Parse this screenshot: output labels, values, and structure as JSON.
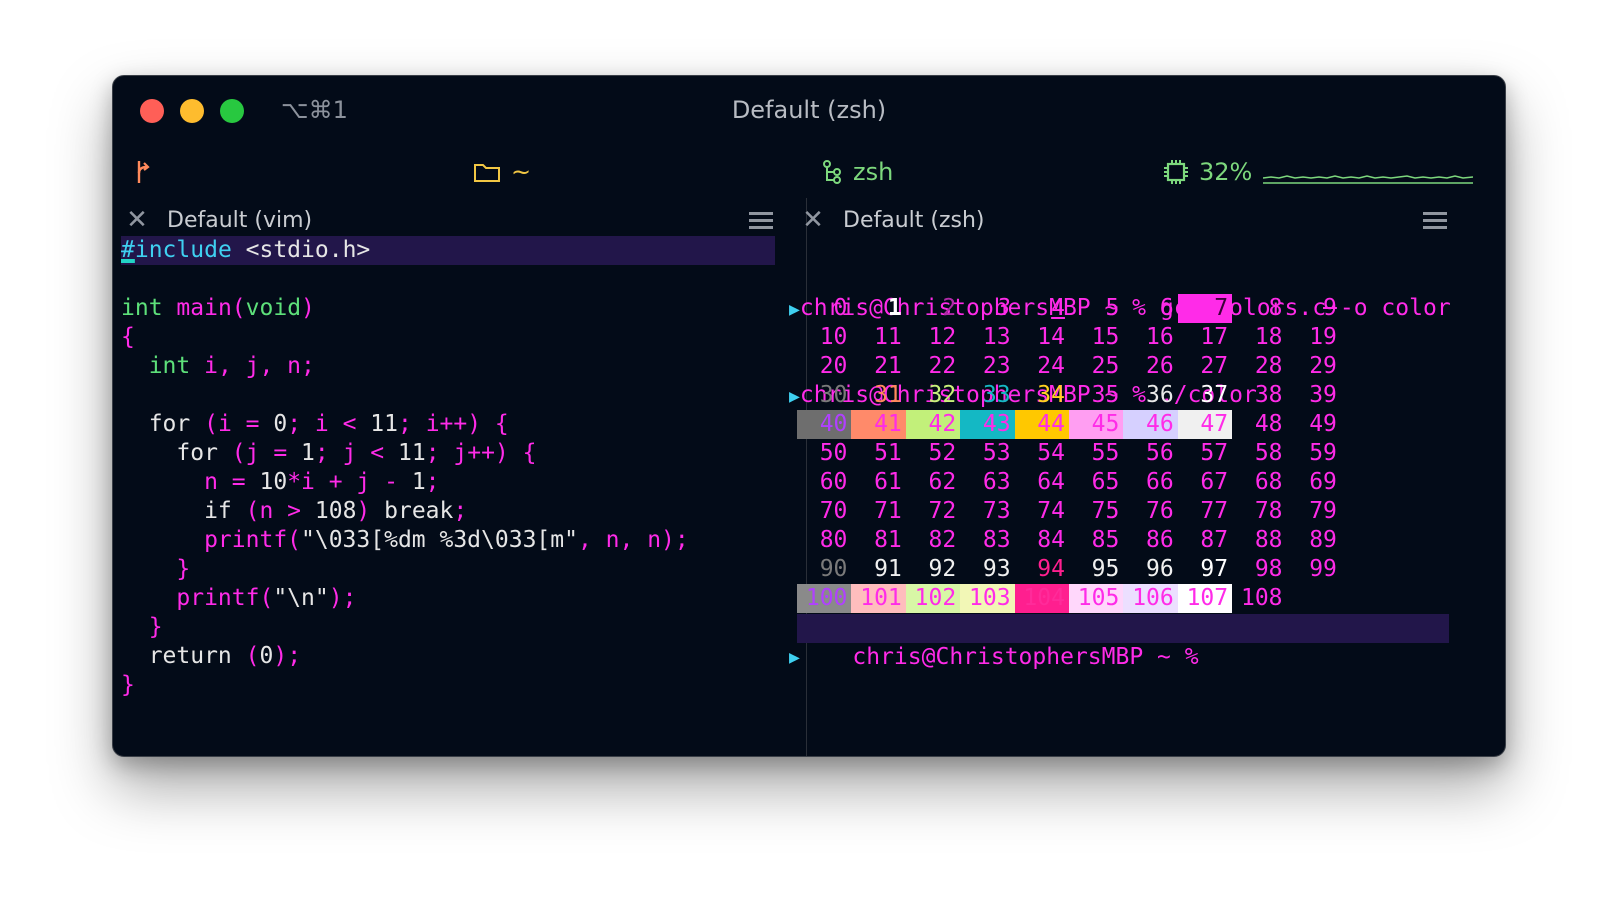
{
  "window": {
    "shortcut": "⌥⌘1",
    "title": "Default (zsh)"
  },
  "statusbar": {
    "dir": "~",
    "shell": "zsh",
    "cpu": "32%"
  },
  "left_pane": {
    "title": "Default (vim)",
    "code": [
      [
        {
          "t": "#",
          "c": "c",
          "u": true
        },
        {
          "t": "include",
          "c": "c"
        },
        {
          "t": " <stdio.h>",
          "c": "w"
        }
      ],
      [],
      [
        {
          "t": "int",
          "c": "k"
        },
        {
          "t": " ",
          "c": "w"
        },
        {
          "t": "main",
          "c": "p"
        },
        {
          "t": "(",
          "c": "p"
        },
        {
          "t": "void",
          "c": "k"
        },
        {
          "t": ")",
          "c": "p"
        }
      ],
      [
        {
          "t": "{",
          "c": "p"
        }
      ],
      [
        {
          "t": "  int",
          "c": "k"
        },
        {
          "t": " i, j, n;",
          "c": "p"
        }
      ],
      [],
      [
        {
          "t": "  for",
          "c": "w"
        },
        {
          "t": " (i = ",
          "c": "p"
        },
        {
          "t": "0",
          "c": "w"
        },
        {
          "t": "; i < ",
          "c": "p"
        },
        {
          "t": "11",
          "c": "w"
        },
        {
          "t": "; i++) {",
          "c": "p"
        }
      ],
      [
        {
          "t": "    for",
          "c": "w"
        },
        {
          "t": " (j = ",
          "c": "p"
        },
        {
          "t": "1",
          "c": "w"
        },
        {
          "t": "; j < ",
          "c": "p"
        },
        {
          "t": "11",
          "c": "w"
        },
        {
          "t": "; j++) {",
          "c": "p"
        }
      ],
      [
        {
          "t": "      n = ",
          "c": "p"
        },
        {
          "t": "10",
          "c": "w"
        },
        {
          "t": "*i + j - ",
          "c": "p"
        },
        {
          "t": "1",
          "c": "w"
        },
        {
          "t": ";",
          "c": "p"
        }
      ],
      [
        {
          "t": "      if",
          "c": "w"
        },
        {
          "t": " (n > ",
          "c": "p"
        },
        {
          "t": "108",
          "c": "w"
        },
        {
          "t": ") ",
          "c": "p"
        },
        {
          "t": "break",
          "c": "w"
        },
        {
          "t": ";",
          "c": "p"
        }
      ],
      [
        {
          "t": "      printf(",
          "c": "p"
        },
        {
          "t": "\"\\033[%dm %3d\\033[m\"",
          "c": "w"
        },
        {
          "t": ", n, n);",
          "c": "p"
        }
      ],
      [
        {
          "t": "    }",
          "c": "p"
        }
      ],
      [
        {
          "t": "    printf(",
          "c": "p"
        },
        {
          "t": "\"\\n\"",
          "c": "w"
        },
        {
          "t": ");",
          "c": "p"
        }
      ],
      [
        {
          "t": "  }",
          "c": "p"
        }
      ],
      [
        {
          "t": "  return",
          "c": "w"
        },
        {
          "t": " (",
          "c": "p"
        },
        {
          "t": "0",
          "c": "w"
        },
        {
          "t": ");",
          "c": "p"
        }
      ],
      [
        {
          "t": "}",
          "c": "p"
        }
      ]
    ]
  },
  "right_pane": {
    "title": "Default (zsh)",
    "prompt": "chris@ChristophersMBP ~ %",
    "commands": [
      " gcc colors.c -o color",
      " ./color"
    ],
    "color_grid": [
      [
        "0",
        "1",
        "2",
        "3",
        "4",
        "5",
        "6",
        "7",
        "8",
        "9"
      ],
      [
        "10",
        "11",
        "12",
        "13",
        "14",
        "15",
        "16",
        "17",
        "18",
        "19"
      ],
      [
        "20",
        "21",
        "22",
        "23",
        "24",
        "25",
        "26",
        "27",
        "28",
        "29"
      ],
      [
        "30",
        "31",
        "32",
        "33",
        "34",
        "35",
        "36",
        "37",
        "38",
        "39"
      ],
      [
        "40",
        "41",
        "42",
        "43",
        "44",
        "45",
        "46",
        "47",
        "48",
        "49"
      ],
      [
        "50",
        "51",
        "52",
        "53",
        "54",
        "55",
        "56",
        "57",
        "58",
        "59"
      ],
      [
        "60",
        "61",
        "62",
        "63",
        "64",
        "65",
        "66",
        "67",
        "68",
        "69"
      ],
      [
        "70",
        "71",
        "72",
        "73",
        "74",
        "75",
        "76",
        "77",
        "78",
        "79"
      ],
      [
        "80",
        "81",
        "82",
        "83",
        "84",
        "85",
        "86",
        "87",
        "88",
        "89"
      ],
      [
        "90",
        "91",
        "92",
        "93",
        "94",
        "95",
        "96",
        "97",
        "98",
        "99"
      ],
      [
        "100",
        "101",
        "102",
        "103",
        "104",
        "105",
        "106",
        "107",
        "108"
      ]
    ],
    "colors": {
      "fg30": "#7a7a7a",
      "fg31": "#ff8a5c",
      "fg32": "#c8f07a",
      "fg33": "#16b8c4",
      "fg34": "#ffd21f",
      "fg35": "#ff2be8",
      "fg36": "#e8e8e8",
      "fg37": "#ffffff",
      "bg40": "#6e6e6e",
      "bg41": "#ff8a6a",
      "bg42": "#c2f07a",
      "bg43": "#14b8c4",
      "bg44": "#ffc800",
      "bg45": "#ff9ef2",
      "bg46": "#d6d0ff",
      "bg47": "#f0f0f0",
      "bg100": "#8a8a8a",
      "bg101": "#ffbdbd",
      "bg102": "#d8f7a6",
      "bg103": "#f2f7b6",
      "bg104": "#ff1f8f",
      "bg105": "#ffd7fb",
      "bg106": "#ecdfff",
      "bg107": "#ffffff",
      "accent": "#ff2be8"
    }
  }
}
